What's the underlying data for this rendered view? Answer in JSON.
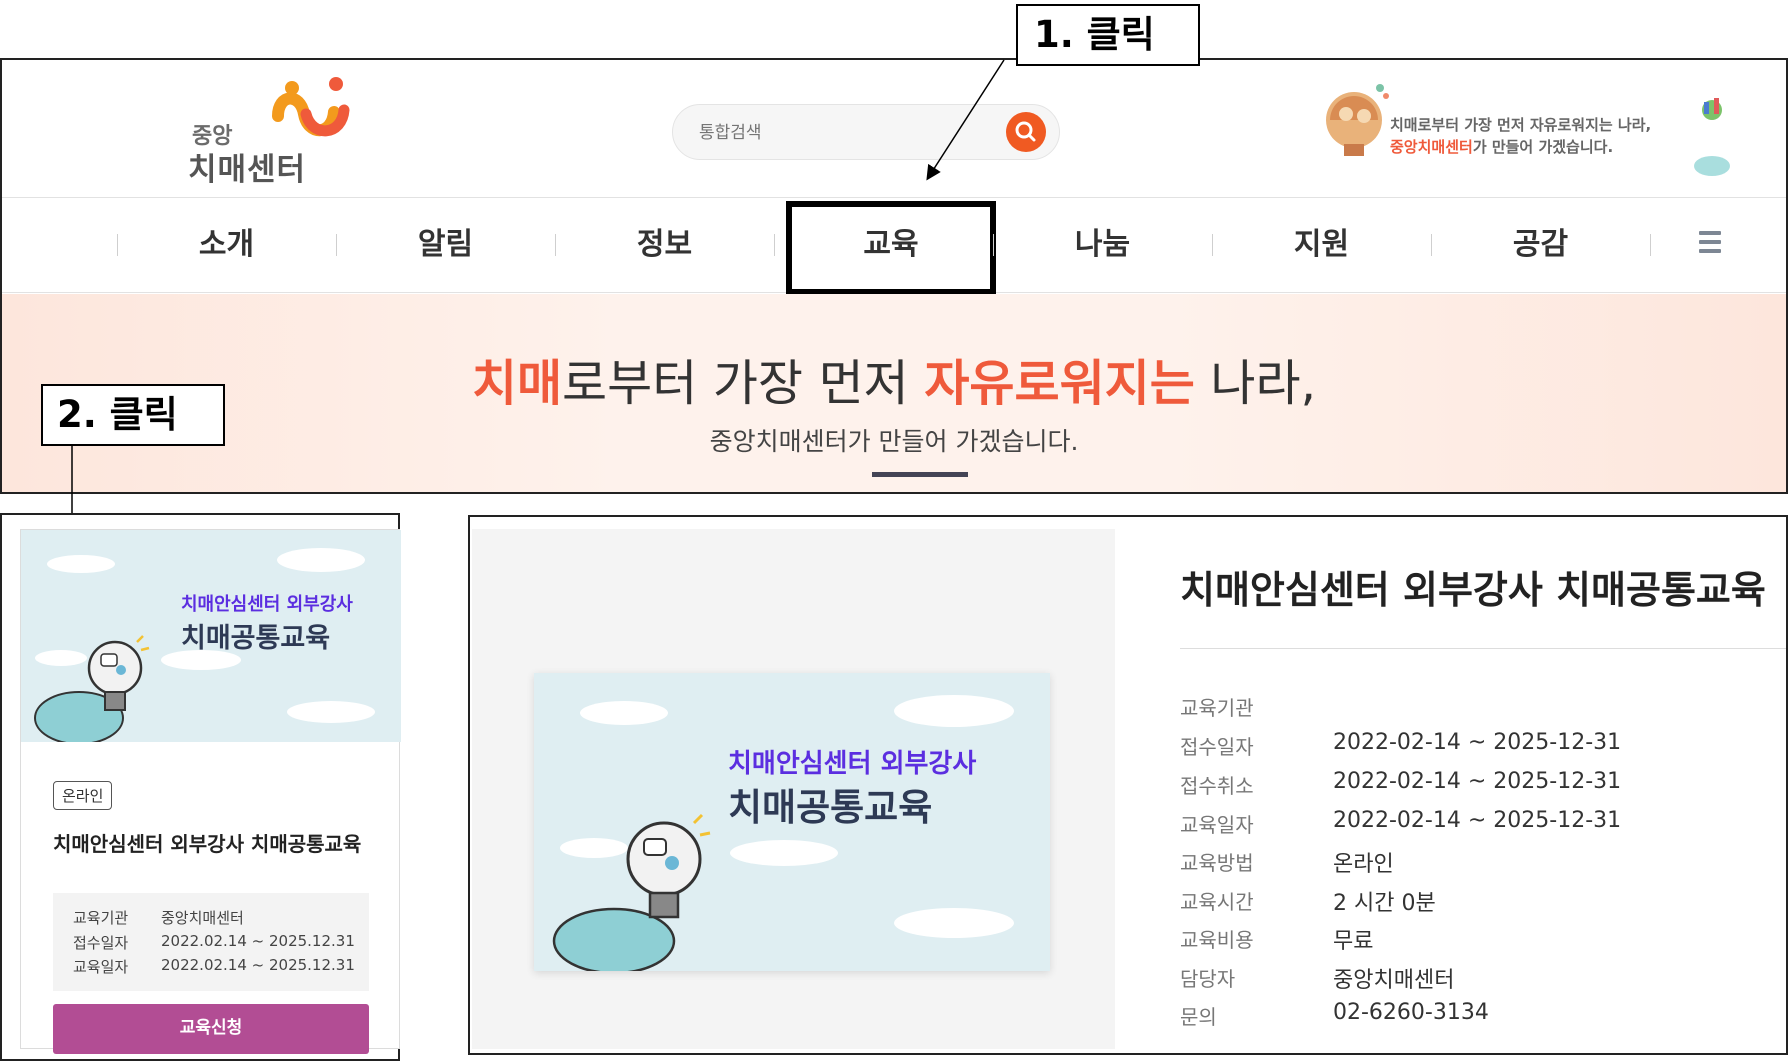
{
  "callouts": {
    "first": "1. 클릭",
    "second": "2. 클릭"
  },
  "header": {
    "logo": {
      "line1": "중앙",
      "line2": "치매센터"
    },
    "search": {
      "placeholder": "통합검색"
    },
    "tagline": {
      "line1": "치매로부터 가장 먼저 자유로워지는 나라,",
      "line2_highlight": "중앙치매센터",
      "line2_rest": "가 만들어 가겠습니다."
    }
  },
  "nav": {
    "items": [
      {
        "label": "소개"
      },
      {
        "label": "알림"
      },
      {
        "label": "정보"
      },
      {
        "label": "교육"
      },
      {
        "label": "나눔"
      },
      {
        "label": "지원"
      },
      {
        "label": "공감"
      }
    ],
    "active_index": 3
  },
  "banner": {
    "head_hl1": "치매",
    "head_mid": "로부터 가장 먼저 ",
    "head_hl2": "자유로워지는",
    "head_end": " 나라,",
    "sub": "중앙치매센터가 만들어 가겠습니다."
  },
  "card": {
    "thumb_line1": "치매안심센터 외부강사",
    "thumb_line2": "치매공통교육",
    "badge": "온라인",
    "title": "치매안심센터 외부강사 치매공통교육",
    "info": [
      {
        "label": "교육기관",
        "value": "중앙치매센터"
      },
      {
        "label": "접수일자",
        "value": "2022.02.14 ~ 2025.12.31"
      },
      {
        "label": "교육일자",
        "value": "2022.02.14 ~ 2025.12.31"
      }
    ],
    "apply_label": "교육신청"
  },
  "detail": {
    "thumb_line1": "치매안심센터 외부강사",
    "thumb_line2": "치매공통교육",
    "title": "치매안심센터 외부강사 치매공통교육",
    "rows": [
      {
        "label": "교육기관",
        "value": ""
      },
      {
        "label": "접수일자",
        "value": "2022-02-14 ~ 2025-12-31"
      },
      {
        "label": "접수취소",
        "value": "2022-02-14 ~ 2025-12-31"
      },
      {
        "label": "교육일자",
        "value": "2022-02-14 ~ 2025-12-31"
      },
      {
        "label": "교육방법",
        "value": "온라인"
      },
      {
        "label": "교육시간",
        "value": "2 시간 0분"
      },
      {
        "label": "교육비용",
        "value": "무료"
      },
      {
        "label": "담당자",
        "value": "중앙치매센터"
      },
      {
        "label": "문의",
        "value": "02-6260-3134"
      }
    ]
  },
  "colors": {
    "accent": "#ef5a3b",
    "search_button": "#f05a22",
    "apply_button": "#b24d94",
    "thumb_title": "#5b2ee0",
    "banner_bg": "#fef2ec",
    "thumb_bg": "#dfeef2"
  },
  "icons": {
    "search": "magnifier-icon",
    "menu": "hamburger-menu-icon",
    "logo_mark": "logo-figures-icon",
    "thumbnail_illustration": "lightbulb-icon"
  }
}
